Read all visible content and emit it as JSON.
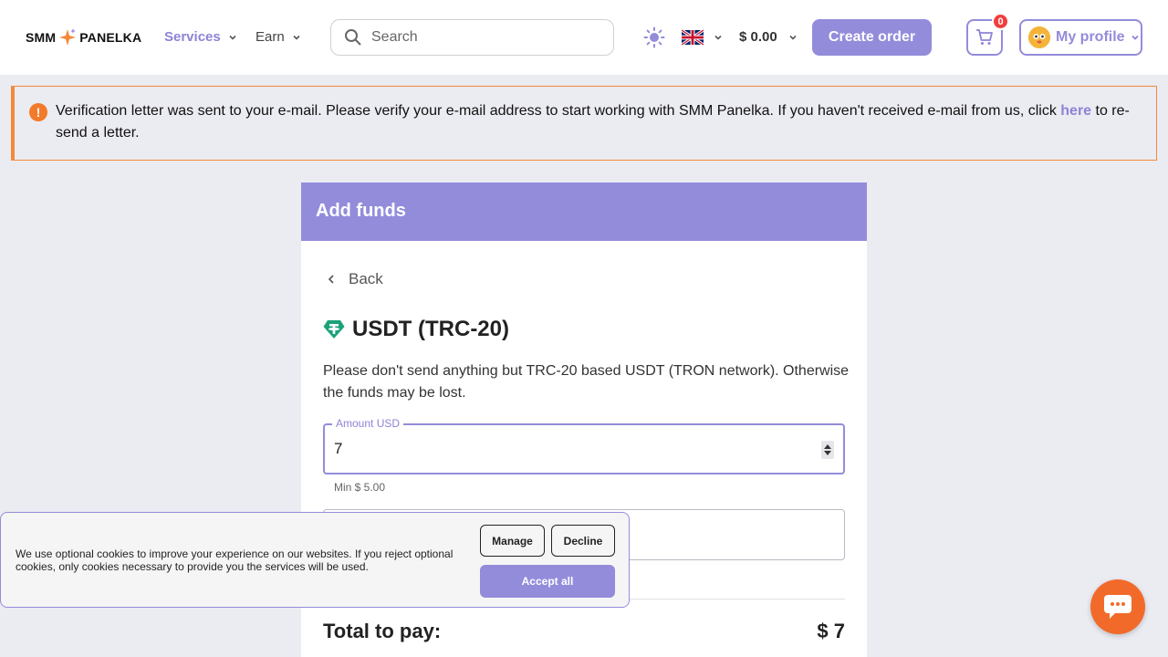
{
  "header": {
    "logo_left": "SMM",
    "logo_right": "PANELKA",
    "nav": {
      "services": "Services",
      "earn": "Earn"
    },
    "search_placeholder": "Search",
    "balance": "$ 0.00",
    "create_order": "Create order",
    "cart_count": "0",
    "profile": "My profile",
    "language_icon": "uk-flag-icon",
    "theme_icon": "sun-icon"
  },
  "alert": {
    "text_before": "Verification letter was sent to your e-mail. Please verify your e-mail address to start working with SMM Panelka. If you haven't received e-mail from us, click ",
    "link": "here",
    "text_after": " to re-send a letter."
  },
  "card": {
    "title": "Add funds",
    "back": "Back",
    "method": "USDT (TRC-20)",
    "warning": "Please don't send anything but TRC-20 based USDT (TRON network). Otherwise the funds may be lost.",
    "amount_label": "Amount USD",
    "amount_value": "7",
    "min_note": "Min $ 5.00",
    "total_label": "Total to pay:",
    "total_value": "$ 7"
  },
  "cookie": {
    "text": "We use optional cookies to improve your experience on our websites. If you reject optional cookies, only cookies necessary to provide you the services will be used.",
    "manage": "Manage",
    "decline": "Decline",
    "accept": "Accept all"
  },
  "colors": {
    "accent": "#938cdb",
    "warning": "#f28a3c",
    "chat": "#f26a2a"
  }
}
